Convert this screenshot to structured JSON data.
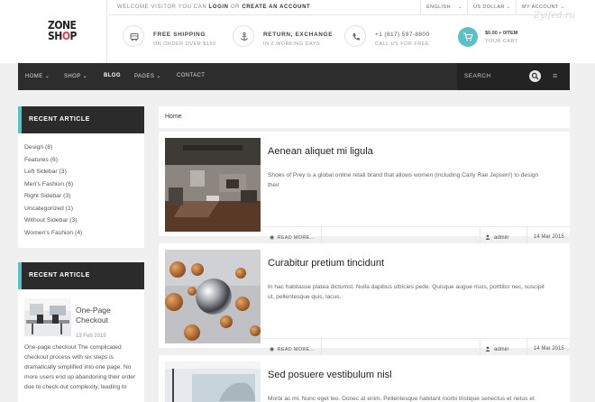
{
  "logo": {
    "line1": "ZONE",
    "line2a": "SH",
    "line2b": "O",
    "line2c": "P"
  },
  "topbar": {
    "welcome_prefix": "WELCOME VISITOR YOU CAN",
    "login": "LOGIN",
    "or": "OR",
    "create": "CREATE AN ACCOUNT",
    "language": "ENGLISH",
    "currency": "US DOLLAR",
    "account": "MY ACCOUNT"
  },
  "watermark": "Zyifed.ru",
  "features": [
    {
      "icon": "truck-icon",
      "title": "FREE SHIPPING",
      "subtitle": "ON ORDER OVER $150"
    },
    {
      "icon": "anchor-icon",
      "title": "RETURN, EXCHANGE",
      "subtitle": "IN 2 WORKING DAYS"
    },
    {
      "icon": "phone-icon",
      "title": "+1 (817) 597-8800",
      "subtitle": "CALL US FOR FREE"
    }
  ],
  "cart": {
    "amount": "$0.00 + 0ITEM",
    "label": "YOUR CART",
    "icon": "cart-icon"
  },
  "nav": {
    "items": [
      {
        "label": "HOME",
        "has_caret": true
      },
      {
        "label": "SHOP",
        "has_caret": true
      },
      {
        "label": "BLOG",
        "has_caret": false
      },
      {
        "label": "PAGES",
        "has_caret": true
      },
      {
        "label": "CONTACT",
        "has_caret": false
      }
    ],
    "search_label": "SEARCH"
  },
  "sidebar": {
    "categories_title": "RECENT ARTICLE",
    "categories": [
      "Design (8)",
      "Features (6)",
      "Left Sidebar (3)",
      "Men's Fashion (6)",
      "Right Sidebar (3)",
      "Uncategorized (1)",
      "Without Sidebar (3)",
      "Women's Fashion (4)"
    ],
    "recent_title": "RECENT ARTICLE",
    "recent_post": {
      "title_line1": "One-Page",
      "title_line2": "Checkout",
      "date": "13 Feb 2015",
      "text": [
        "One-page checkout The complicated",
        "checkout process with six steps is",
        "dramatically simplified into one page. No",
        "more users end up abandoning their order",
        "due to check-out complexity, leading to"
      ]
    }
  },
  "breadcrumb": "Home",
  "posts": [
    {
      "title": "Aenean aliquet mi ligula",
      "excerpt": "Shoes of Prey is a global online retail brand that allows women (including Carly Rae Jepsen!) to design their",
      "read_more": "READ MORE...",
      "author": "admin",
      "date": "14 Mar 2015"
    },
    {
      "title": "Curabitur pretium tincidunt",
      "excerpt": "In hac habitasse platea dictumst. Nulla dapibus ultricies pede. Quisque augue risus, porttitor nec, suscipit ut, pellentesque quis, lacus.",
      "read_more": "READ MORE...",
      "author": "admin",
      "date": "14 Mar 2015"
    },
    {
      "title": "Sed posuere vestibulum nisl",
      "excerpt": "Morbi ac mi. Nunc eget leo. Donec at enim. Pellentesque habitant morbi tristique senectus et netus et",
      "read_more": "",
      "author": "",
      "date": ""
    }
  ],
  "colors": {
    "accent": "#5bc0c8",
    "logo_accent": "#e23a44",
    "nav_bg": "#2d2d2d"
  }
}
